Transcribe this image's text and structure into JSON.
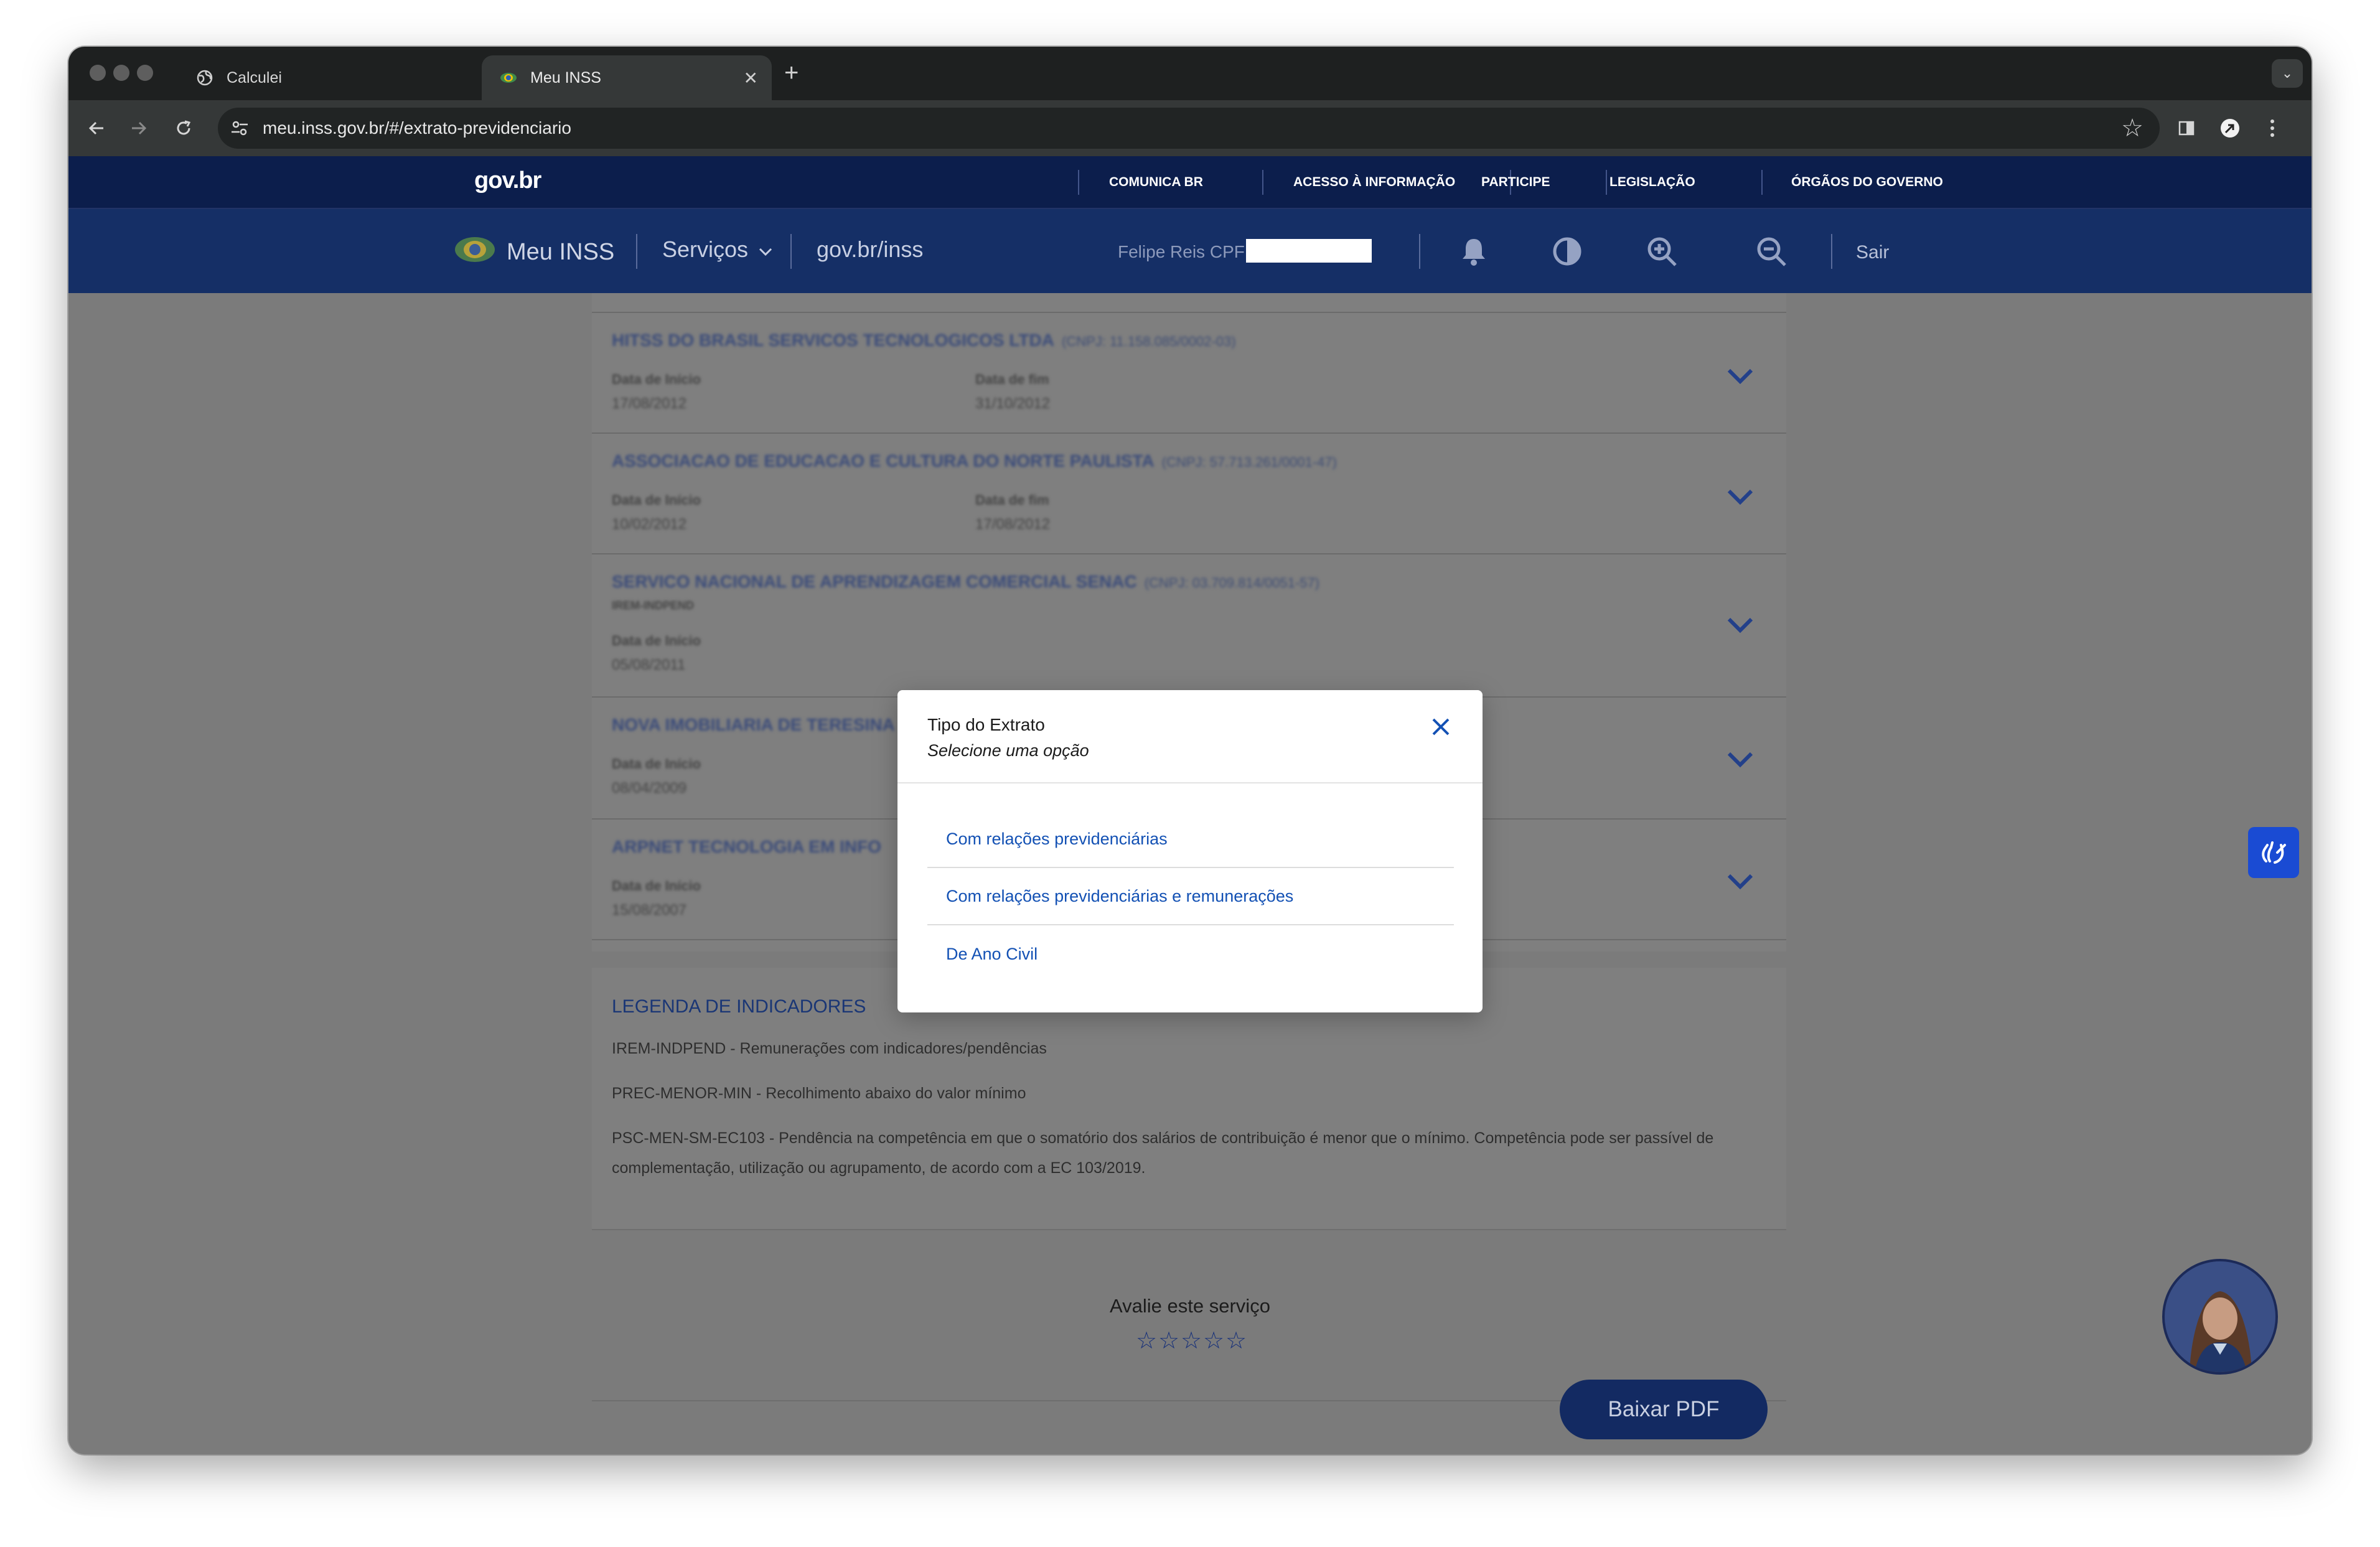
{
  "browser": {
    "tabs": [
      {
        "title": "Calculei",
        "active": false,
        "icon": "globe-icon"
      },
      {
        "title": "Meu INSS",
        "active": true,
        "icon": "inss-favicon"
      }
    ],
    "close_glyph": "✕",
    "new_tab_glyph": "+",
    "dropdown_glyph": "⌄",
    "url": "meu.inss.gov.br/#/extrato-previdenciario",
    "star_glyph": "☆"
  },
  "gov_bar": {
    "logo": "gov.br",
    "links": [
      "COMUNICA BR",
      "ACESSO À INFORMAÇÃO",
      "PARTICIPE",
      "LEGISLAÇÃO",
      "ÓRGÃOS DO GOVERNO"
    ]
  },
  "inss_bar": {
    "title": "Meu INSS",
    "services": "Serviços",
    "govbr_inss": "gov.br/inss",
    "user": "Felipe Reis",
    "cpf_label": "CPF",
    "logout": "Sair"
  },
  "employers": [
    {
      "name": "HITSS DO BRASIL SERVICOS TECNOLOGICOS LTDA",
      "cnpj": "(CNPJ: 11.158.085/0002-03)",
      "fields": [
        {
          "label": "Data de Início",
          "value": "17/08/2012"
        },
        {
          "label": "Data de fim",
          "value": "31/10/2012"
        }
      ]
    },
    {
      "name": "ASSOCIACAO DE EDUCACAO E CULTURA DO NORTE PAULISTA",
      "cnpj": "(CNPJ: 57.713.261/0001-47)",
      "fields": [
        {
          "label": "Data de Início",
          "value": "10/02/2012"
        },
        {
          "label": "Data de fim",
          "value": "17/08/2012"
        }
      ]
    },
    {
      "name": "SERVICO NACIONAL DE APRENDIZAGEM COMERCIAL SENAC",
      "cnpj": "(CNPJ: 03.709.814/0051-57)",
      "tag": "IREM-INDPEND",
      "fields": [
        {
          "label": "Data de Início",
          "value": "05/08/2011"
        }
      ]
    },
    {
      "name": "NOVA IMOBILIARIA DE TERESINA",
      "cnpj": "",
      "fields": [
        {
          "label": "Data de Início",
          "value": "08/04/2009"
        }
      ]
    },
    {
      "name": "ARPNET TECNOLOGIA EM INFO",
      "cnpj": "",
      "fields": [
        {
          "label": "Data de Início",
          "value": "15/08/2007"
        }
      ]
    }
  ],
  "legend": {
    "title": "LEGENDA DE INDICADORES",
    "items": [
      "IREM-INDPEND - Remunerações com indicadores/pendências",
      "PREC-MENOR-MIN - Recolhimento abaixo do valor mínimo",
      "PSC-MEN-SM-EC103 - Pendência na competência em que o somatório dos salários de contribuição é menor que o mínimo. Competência pode ser passível de complementação, utilização ou agrupamento, de acordo com a EC 103/2019."
    ]
  },
  "rating": {
    "title": "Avalie este serviço",
    "stars": [
      "☆",
      "☆",
      "☆",
      "☆",
      "☆"
    ]
  },
  "actions": {
    "download_pdf": "Baixar PDF"
  },
  "modal": {
    "title": "Tipo do Extrato",
    "subtitle": "Selecione uma opção",
    "options": [
      "Com relações previdenciárias",
      "Com relações previdenciárias e remunerações",
      "De Ano Civil"
    ]
  },
  "colors": {
    "gov_bar": "#0c1e4c",
    "inss_bar": "#152f66",
    "link_blue": "#1351b4",
    "button_dark": "#132a62",
    "overlay": "#7b7b7b"
  }
}
